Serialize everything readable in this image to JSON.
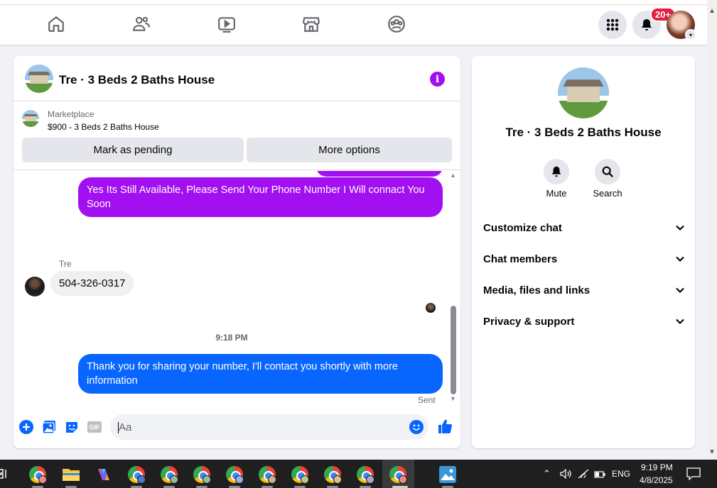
{
  "nav": {
    "notification_count": "20+",
    "icons": [
      "home-icon",
      "friends-icon",
      "video-icon",
      "marketplace-icon",
      "groups-icon",
      "menu-grid-icon",
      "bell-icon"
    ]
  },
  "chat": {
    "title": "Tre · 3 Beds 2 Baths House",
    "marketplace_label": "Marketplace",
    "listing": "$900 - 3 Beds 2 Baths House",
    "mark_pending": "Mark as pending",
    "more_options": "More options",
    "messages": [
      {
        "from": "me",
        "color": "#a20ff0",
        "text": "Yes Its Still Available, Please Send Your Phone Number I Will connact You Soon"
      },
      {
        "from": "Tre",
        "sender_name": "Tre",
        "text": "504-326-0317"
      },
      {
        "from": "me",
        "color": "#0866ff",
        "text": "Thank you for sharing your number, I'll contact you shortly with more information"
      }
    ],
    "time_separator": "9:18 PM",
    "status": "Sent",
    "composer_placeholder": "Aa"
  },
  "info": {
    "title": "Tre · 3 Beds 2 Baths House",
    "mute": "Mute",
    "search": "Search",
    "sections": [
      "Customize chat",
      "Chat members",
      "Media, files and links",
      "Privacy & support"
    ]
  },
  "taskbar": {
    "lang": "ENG",
    "time": "9:19 PM",
    "date": "4/8/2025"
  },
  "colors": {
    "accent_purple": "#a20ff0",
    "messenger_blue": "#0866ff",
    "icon_blue": "#0866ff"
  }
}
